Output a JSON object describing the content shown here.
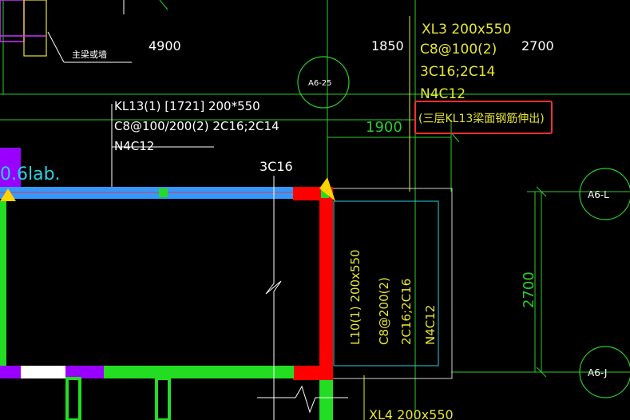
{
  "labels": {
    "wall_note": "主梁或墙",
    "dim_4900": "4900",
    "dim_1850": "1850",
    "dim_2700_top": "2700",
    "dim_1900": "1900",
    "dim_2700_side": "2700",
    "axis_a6_25": "A6-25",
    "axis_a6_l": "A6-L",
    "axis_a6_j": "A6-J",
    "kl13_line1": "KL13(1) [1721] 200*550",
    "kl13_line2": "C8@100/200(2) 2C16;2C14",
    "kl13_line3": "N4C12",
    "rebar_3c16": "3C16",
    "slab_note": "0.6lab.",
    "xl3_line1": "XL3 200x550",
    "xl3_line2": "C8@100(2)",
    "xl3_line3": "3C16;2C14",
    "xl3_line4": "N4C12",
    "callout": "(三层KL13梁面钢筋伸出)",
    "l10_line1": "L10(1) 200x550",
    "l10_line2": "C8@200(2)",
    "l10_line3": "2C16;2C16",
    "l10_line4": "N4C12",
    "xl4_line1": "XL4 200x550"
  },
  "colors": {
    "background": "#000000",
    "beam_blue": "#3399ff",
    "beam_red": "#ff0000",
    "beam_green": "#22dd22",
    "magenta": "#9900ff",
    "yellow_text": "#e6e633",
    "green_dim": "#2ecc2e",
    "cyan": "#2ad0e0",
    "callout_box": "#ff3030"
  }
}
